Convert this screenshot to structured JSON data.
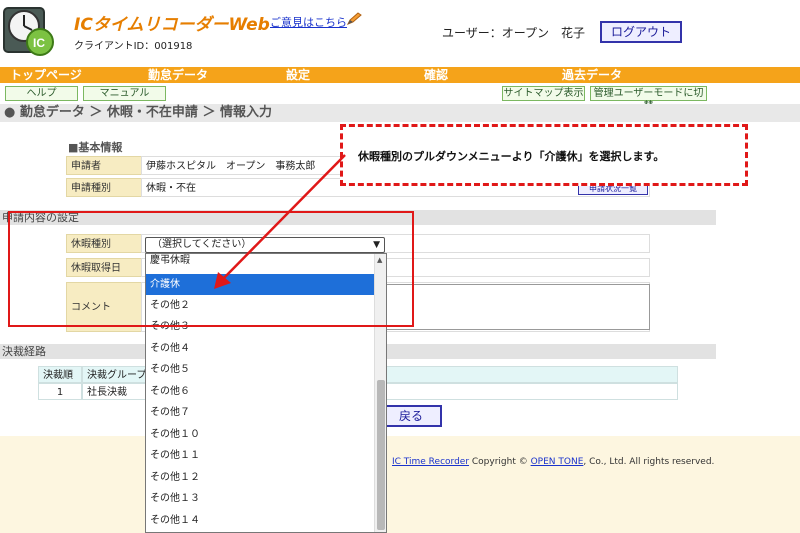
{
  "header": {
    "app_title": "ICタイムリコーダーWeb",
    "client_id": "クライアントID：001918",
    "feedback_link": "ご意見はこちら",
    "user_label": "ユーザー：オープン　花子",
    "logout_label": "ログアウト"
  },
  "nav": {
    "items": [
      "トップページ",
      "勤怠データ",
      "設定",
      "確認",
      "過去データ"
    ]
  },
  "subnav": {
    "help": "ヘルプ",
    "manual": "マニュアル",
    "sitemap": "サイトマップ表示",
    "admin_mode": "管理ユーザーモードに切替"
  },
  "breadcrumb": "● 勤怠データ ＞ 休暇・不在申請 ＞ 情報入力",
  "basic_info": {
    "section_label": "■基本情報",
    "rows": [
      {
        "label": "申請者",
        "value": "伊藤ホスピタル　オープン　事務太郎"
      },
      {
        "label": "申請種別",
        "value": "休暇・不在"
      }
    ],
    "list_button": "申請状況一覧"
  },
  "request_settings": {
    "section_label": "申請内容の設定",
    "leave_type_label": "休暇種別",
    "leave_type_value": "（選択してください）",
    "leave_date_label": "休暇取得日",
    "comment_label": "コメント"
  },
  "approval_route": {
    "section_label": "決裁経路",
    "headers": [
      "決裁順",
      "決裁グループ"
    ],
    "rows": [
      [
        "1",
        "社長決裁"
      ]
    ]
  },
  "back_button": "戻る",
  "footer": {
    "product_link": "IC Time Recorder",
    "copyright_prefix": " Copyright © ",
    "company_link": "OPEN TONE",
    "copyright_suffix": ", Co., Ltd. All rights reserved."
  },
  "dropdown": {
    "options": [
      "慶弔休暇",
      "介護休",
      "その他２",
      "その他３",
      "その他４",
      "その他５",
      "その他６",
      "その他７",
      "その他１０",
      "その他１１",
      "その他１２",
      "その他１３",
      "その他１４"
    ],
    "selected_index": 1
  },
  "annotation": {
    "callout_text": "休暇種別のプルダウンメニューより「介護休」を選択します。",
    "color": "#e01818"
  },
  "colors": {
    "nav": "#f5a31a",
    "accent": "#e67e00",
    "selected": "#1e6fd9"
  }
}
